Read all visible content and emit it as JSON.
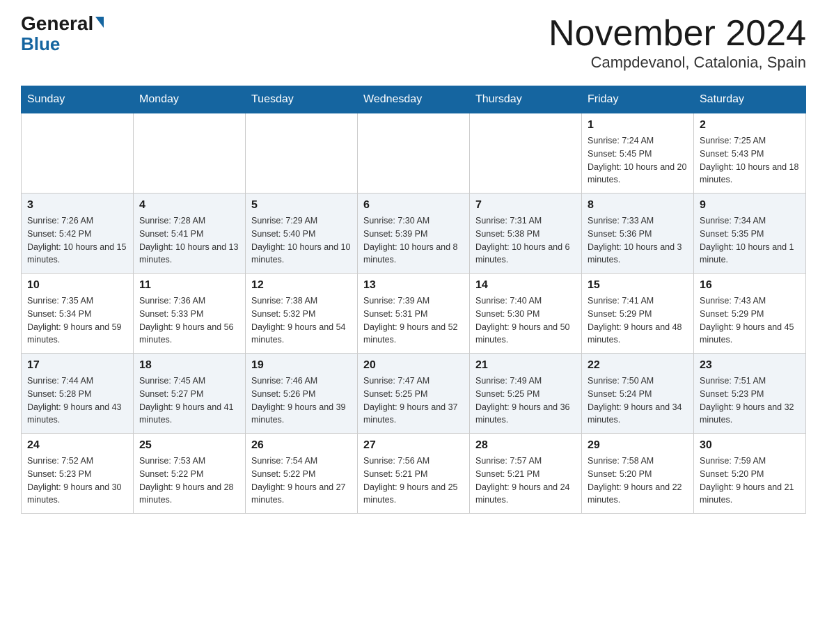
{
  "header": {
    "logo_line1": "General",
    "logo_line2": "Blue",
    "title": "November 2024",
    "subtitle": "Campdevanol, Catalonia, Spain"
  },
  "days_of_week": [
    "Sunday",
    "Monday",
    "Tuesday",
    "Wednesday",
    "Thursday",
    "Friday",
    "Saturday"
  ],
  "weeks": [
    [
      {
        "day": "",
        "sunrise": "",
        "sunset": "",
        "daylight": ""
      },
      {
        "day": "",
        "sunrise": "",
        "sunset": "",
        "daylight": ""
      },
      {
        "day": "",
        "sunrise": "",
        "sunset": "",
        "daylight": ""
      },
      {
        "day": "",
        "sunrise": "",
        "sunset": "",
        "daylight": ""
      },
      {
        "day": "",
        "sunrise": "",
        "sunset": "",
        "daylight": ""
      },
      {
        "day": "1",
        "sunrise": "Sunrise: 7:24 AM",
        "sunset": "Sunset: 5:45 PM",
        "daylight": "Daylight: 10 hours and 20 minutes."
      },
      {
        "day": "2",
        "sunrise": "Sunrise: 7:25 AM",
        "sunset": "Sunset: 5:43 PM",
        "daylight": "Daylight: 10 hours and 18 minutes."
      }
    ],
    [
      {
        "day": "3",
        "sunrise": "Sunrise: 7:26 AM",
        "sunset": "Sunset: 5:42 PM",
        "daylight": "Daylight: 10 hours and 15 minutes."
      },
      {
        "day": "4",
        "sunrise": "Sunrise: 7:28 AM",
        "sunset": "Sunset: 5:41 PM",
        "daylight": "Daylight: 10 hours and 13 minutes."
      },
      {
        "day": "5",
        "sunrise": "Sunrise: 7:29 AM",
        "sunset": "Sunset: 5:40 PM",
        "daylight": "Daylight: 10 hours and 10 minutes."
      },
      {
        "day": "6",
        "sunrise": "Sunrise: 7:30 AM",
        "sunset": "Sunset: 5:39 PM",
        "daylight": "Daylight: 10 hours and 8 minutes."
      },
      {
        "day": "7",
        "sunrise": "Sunrise: 7:31 AM",
        "sunset": "Sunset: 5:38 PM",
        "daylight": "Daylight: 10 hours and 6 minutes."
      },
      {
        "day": "8",
        "sunrise": "Sunrise: 7:33 AM",
        "sunset": "Sunset: 5:36 PM",
        "daylight": "Daylight: 10 hours and 3 minutes."
      },
      {
        "day": "9",
        "sunrise": "Sunrise: 7:34 AM",
        "sunset": "Sunset: 5:35 PM",
        "daylight": "Daylight: 10 hours and 1 minute."
      }
    ],
    [
      {
        "day": "10",
        "sunrise": "Sunrise: 7:35 AM",
        "sunset": "Sunset: 5:34 PM",
        "daylight": "Daylight: 9 hours and 59 minutes."
      },
      {
        "day": "11",
        "sunrise": "Sunrise: 7:36 AM",
        "sunset": "Sunset: 5:33 PM",
        "daylight": "Daylight: 9 hours and 56 minutes."
      },
      {
        "day": "12",
        "sunrise": "Sunrise: 7:38 AM",
        "sunset": "Sunset: 5:32 PM",
        "daylight": "Daylight: 9 hours and 54 minutes."
      },
      {
        "day": "13",
        "sunrise": "Sunrise: 7:39 AM",
        "sunset": "Sunset: 5:31 PM",
        "daylight": "Daylight: 9 hours and 52 minutes."
      },
      {
        "day": "14",
        "sunrise": "Sunrise: 7:40 AM",
        "sunset": "Sunset: 5:30 PM",
        "daylight": "Daylight: 9 hours and 50 minutes."
      },
      {
        "day": "15",
        "sunrise": "Sunrise: 7:41 AM",
        "sunset": "Sunset: 5:29 PM",
        "daylight": "Daylight: 9 hours and 48 minutes."
      },
      {
        "day": "16",
        "sunrise": "Sunrise: 7:43 AM",
        "sunset": "Sunset: 5:29 PM",
        "daylight": "Daylight: 9 hours and 45 minutes."
      }
    ],
    [
      {
        "day": "17",
        "sunrise": "Sunrise: 7:44 AM",
        "sunset": "Sunset: 5:28 PM",
        "daylight": "Daylight: 9 hours and 43 minutes."
      },
      {
        "day": "18",
        "sunrise": "Sunrise: 7:45 AM",
        "sunset": "Sunset: 5:27 PM",
        "daylight": "Daylight: 9 hours and 41 minutes."
      },
      {
        "day": "19",
        "sunrise": "Sunrise: 7:46 AM",
        "sunset": "Sunset: 5:26 PM",
        "daylight": "Daylight: 9 hours and 39 minutes."
      },
      {
        "day": "20",
        "sunrise": "Sunrise: 7:47 AM",
        "sunset": "Sunset: 5:25 PM",
        "daylight": "Daylight: 9 hours and 37 minutes."
      },
      {
        "day": "21",
        "sunrise": "Sunrise: 7:49 AM",
        "sunset": "Sunset: 5:25 PM",
        "daylight": "Daylight: 9 hours and 36 minutes."
      },
      {
        "day": "22",
        "sunrise": "Sunrise: 7:50 AM",
        "sunset": "Sunset: 5:24 PM",
        "daylight": "Daylight: 9 hours and 34 minutes."
      },
      {
        "day": "23",
        "sunrise": "Sunrise: 7:51 AM",
        "sunset": "Sunset: 5:23 PM",
        "daylight": "Daylight: 9 hours and 32 minutes."
      }
    ],
    [
      {
        "day": "24",
        "sunrise": "Sunrise: 7:52 AM",
        "sunset": "Sunset: 5:23 PM",
        "daylight": "Daylight: 9 hours and 30 minutes."
      },
      {
        "day": "25",
        "sunrise": "Sunrise: 7:53 AM",
        "sunset": "Sunset: 5:22 PM",
        "daylight": "Daylight: 9 hours and 28 minutes."
      },
      {
        "day": "26",
        "sunrise": "Sunrise: 7:54 AM",
        "sunset": "Sunset: 5:22 PM",
        "daylight": "Daylight: 9 hours and 27 minutes."
      },
      {
        "day": "27",
        "sunrise": "Sunrise: 7:56 AM",
        "sunset": "Sunset: 5:21 PM",
        "daylight": "Daylight: 9 hours and 25 minutes."
      },
      {
        "day": "28",
        "sunrise": "Sunrise: 7:57 AM",
        "sunset": "Sunset: 5:21 PM",
        "daylight": "Daylight: 9 hours and 24 minutes."
      },
      {
        "day": "29",
        "sunrise": "Sunrise: 7:58 AM",
        "sunset": "Sunset: 5:20 PM",
        "daylight": "Daylight: 9 hours and 22 minutes."
      },
      {
        "day": "30",
        "sunrise": "Sunrise: 7:59 AM",
        "sunset": "Sunset: 5:20 PM",
        "daylight": "Daylight: 9 hours and 21 minutes."
      }
    ]
  ]
}
